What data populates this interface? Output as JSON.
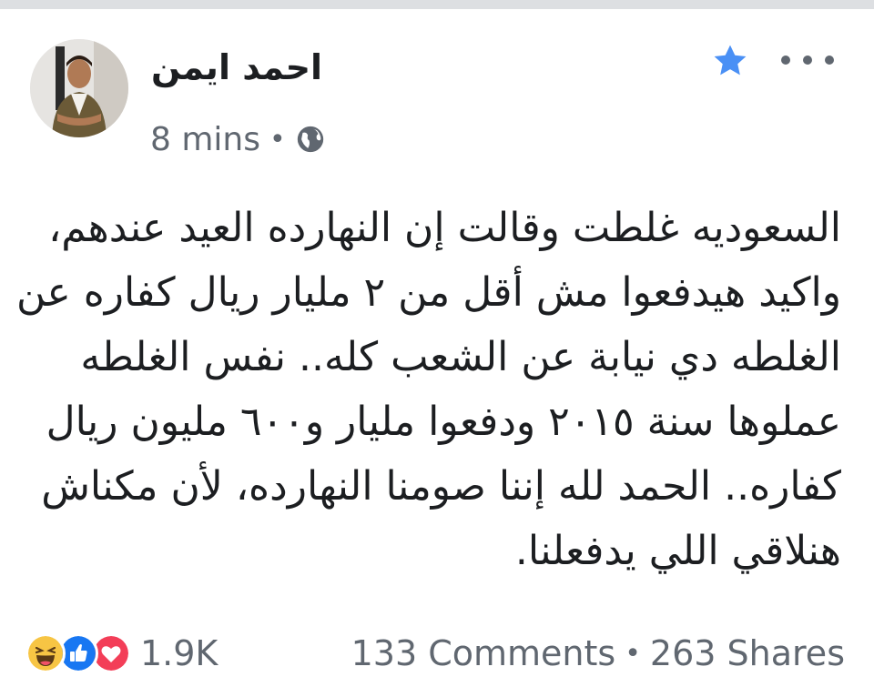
{
  "post": {
    "author": "احمد ايمن",
    "time": "8 mins",
    "separator": "•",
    "privacy_icon": "globe-icon",
    "favorite_icon": "star-icon",
    "favorite_color": "#4a90f5",
    "more_icon": "more-dots-icon",
    "lines": [
      "السعوديه غلطت وقالت إن النهارده العيد عندهم،",
      "واكيد هيدفعوا مش أقل من ٢ مليار ريال كفاره عن",
      "الغلطه دي نيابة عن الشعب كله.. نفس الغلطه",
      "عملوها سنة ٢٠١٥ ودفعوا مليار و٦٠٠ مليون ريال",
      "كفاره.. الحمد لله إننا صومنا النهارده، لأن مكناش",
      "هنلاقي اللي يدفعلنا."
    ]
  },
  "reactions": {
    "icons": [
      "haha-icon",
      "like-icon",
      "love-icon"
    ],
    "count": "1.9K"
  },
  "stats": {
    "comments": "133 Comments",
    "separator": "•",
    "shares": "263 Shares"
  }
}
